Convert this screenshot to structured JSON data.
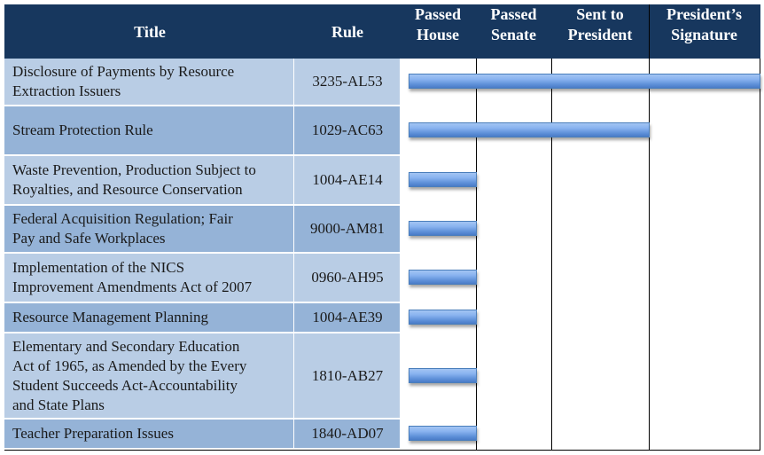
{
  "header": {
    "title": "Title",
    "rule": "Rule",
    "stages": [
      {
        "line1": "Passed",
        "line2": "House"
      },
      {
        "line1": "Passed",
        "line2": "Senate"
      },
      {
        "line1": "Sent to",
        "line2": "President"
      },
      {
        "line1": "President’s",
        "line2": "Signature"
      }
    ]
  },
  "colors": {
    "header_bg": "#17375E",
    "row_light": "#B9CDE5",
    "row_dark": "#95B3D7",
    "bar": "#5B8FD9"
  },
  "chart_data": {
    "type": "bar",
    "orientation": "horizontal",
    "title": "",
    "xlabel": "",
    "ylabel": "",
    "stages": [
      "Passed House",
      "Passed Senate",
      "Sent to President",
      "President’s Signature"
    ],
    "categories": [
      "Disclosure of Payments by Resource Extraction Issuers",
      "Stream Protection Rule",
      "Waste Prevention, Production Subject to Royalties, and Resource Conservation",
      "Federal Acquisition Regulation; Fair Pay and Safe Workplaces",
      "Implementation of the NICS Improvement Amendments Act of 2007",
      "Resource Management Planning",
      "Elementary and Secondary Education Act of 1965, as Amended by the Every Student Succeeds Act-Accountability and State Plans",
      "Teacher Preparation Issues"
    ],
    "values": [
      4,
      3,
      1,
      1,
      1,
      1,
      1,
      1
    ],
    "value_meaning": "number of stages completed (1 = Passed House ... 4 = President’s Signature)",
    "xlim": [
      0,
      4
    ]
  },
  "rows": [
    {
      "title_lines": [
        "Disclosure of Payments by Resource",
        "Extraction Issuers"
      ],
      "rule": "3235-AL53",
      "stages_completed": 4
    },
    {
      "title_lines": [
        "Stream Protection Rule"
      ],
      "rule": "1029-AC63",
      "stages_completed": 3
    },
    {
      "title_lines": [
        "Waste Prevention, Production Subject to",
        "Royalties, and Resource Conservation"
      ],
      "rule": "1004-AE14",
      "stages_completed": 1
    },
    {
      "title_lines": [
        "Federal Acquisition Regulation; Fair",
        "Pay and Safe Workplaces"
      ],
      "rule": "9000-AM81",
      "stages_completed": 1
    },
    {
      "title_lines": [
        "Implementation of the NICS",
        "Improvement Amendments Act of 2007"
      ],
      "rule": "0960-AH95",
      "stages_completed": 1
    },
    {
      "title_lines": [
        "Resource Management Planning"
      ],
      "rule": "1004-AE39",
      "stages_completed": 1
    },
    {
      "title_lines": [
        "Elementary and Secondary Education",
        "Act of 1965, as Amended by the Every",
        "Student Succeeds Act-Accountability",
        "and State Plans"
      ],
      "rule": "1810-AB27",
      "stages_completed": 1
    },
    {
      "title_lines": [
        "Teacher Preparation Issues"
      ],
      "rule": "1840-AD07",
      "stages_completed": 1
    }
  ]
}
